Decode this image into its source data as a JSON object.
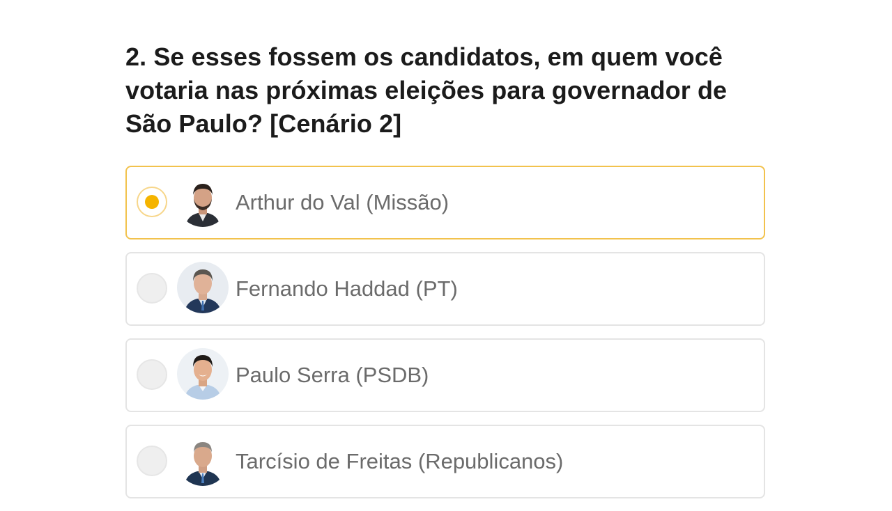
{
  "question": {
    "text": "2. Se esses fossem os candidatos, em quem você votaria nas próximas eleições para governador de São Paulo? [Cenário 2]"
  },
  "options": [
    {
      "label": "Arthur do Val (Missão)",
      "selected": true,
      "icon": "candidate-photo"
    },
    {
      "label": "Fernando Haddad (PT)",
      "selected": false,
      "icon": "candidate-photo"
    },
    {
      "label": "Paulo Serra (PSDB)",
      "selected": false,
      "icon": "candidate-photo"
    },
    {
      "label": "Tarcísio de Freitas (Republicanos)",
      "selected": false,
      "icon": "candidate-photo"
    }
  ],
  "colors": {
    "accent": "#f5b400",
    "selected_border": "#f2c24d",
    "border": "#e4e4e4",
    "question_text": "#1b1b1b",
    "option_text": "#6b6b6b"
  }
}
